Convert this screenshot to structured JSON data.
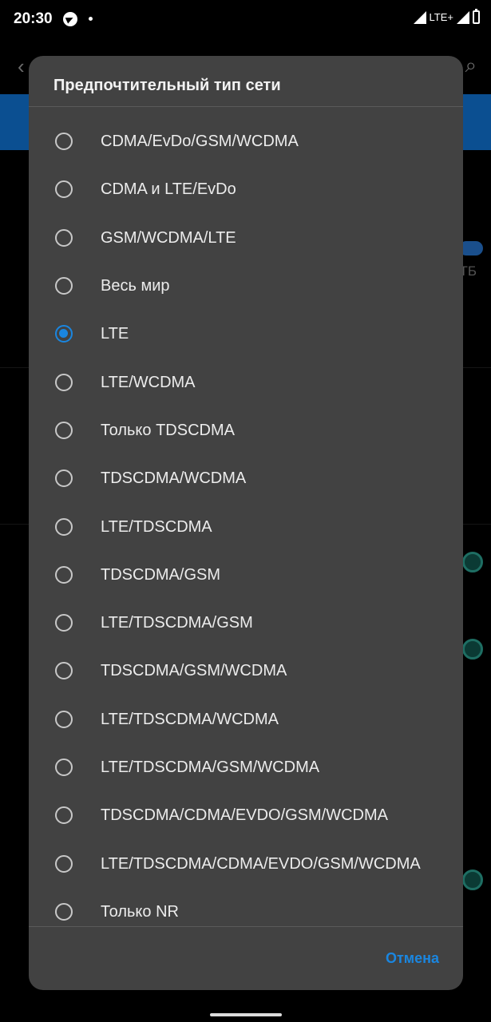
{
  "status_bar": {
    "time": "20:30",
    "network": "LTE+"
  },
  "dialog": {
    "title": "Предпочтительный тип сети",
    "options": [
      {
        "label": "CDMA/EvDo/GSM/WCDMA",
        "selected": false
      },
      {
        "label": "CDMA и LTE/EvDo",
        "selected": false
      },
      {
        "label": "GSM/WCDMA/LTE",
        "selected": false
      },
      {
        "label": "Весь мир",
        "selected": false
      },
      {
        "label": "LTE",
        "selected": true
      },
      {
        "label": "LTE/WCDMA",
        "selected": false
      },
      {
        "label": "Только TDSCDMA",
        "selected": false
      },
      {
        "label": "TDSCDMA/WCDMA",
        "selected": false
      },
      {
        "label": "LTE/TDSCDMA",
        "selected": false
      },
      {
        "label": "TDSCDMA/GSM",
        "selected": false
      },
      {
        "label": "LTE/TDSCDMA/GSM",
        "selected": false
      },
      {
        "label": "TDSCDMA/GSM/WCDMA",
        "selected": false
      },
      {
        "label": "LTE/TDSCDMA/WCDMA",
        "selected": false
      },
      {
        "label": "LTE/TDSCDMA/GSM/WCDMA",
        "selected": false
      },
      {
        "label": "TDSCDMA/CDMA/EVDO/GSM/WCDMA",
        "selected": false
      },
      {
        "label": "LTE/TDSCDMA/CDMA/EVDO/GSM/WCDMA",
        "selected": false
      },
      {
        "label": "Только NR",
        "selected": false
      }
    ],
    "cancel_label": "Отмена"
  },
  "background": {
    "partial_text": "ТБ"
  },
  "colors": {
    "accent": "#1a86e0",
    "dialog_bg": "#424242"
  }
}
